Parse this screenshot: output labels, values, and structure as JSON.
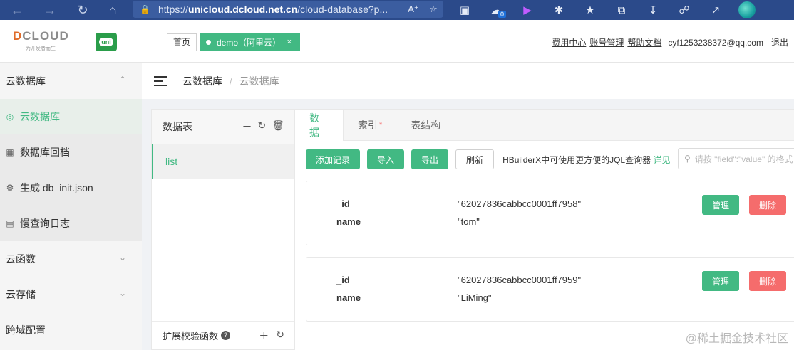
{
  "browser": {
    "url_scheme": "https://",
    "url_host": "unicloud.dcloud.net.cn",
    "url_path": "/cloud-database?p...",
    "notification_badge": "0"
  },
  "header": {
    "logo_text": "DCLOUD",
    "logo_subtitle": "为开发者而生",
    "uni_logo_text": "uni",
    "home_tab": "首页",
    "space_tab": "demo（阿里云）",
    "space_tab_close": "×",
    "links": [
      "费用中心",
      "账号管理",
      "帮助文档"
    ],
    "email": "cyf1253238372@qq.com",
    "logout": "退出"
  },
  "sidebar": {
    "group_cloud_db": "云数据库",
    "items": [
      {
        "label": "云数据库",
        "icon": "database-icon",
        "active": true
      },
      {
        "label": "数据库回档",
        "icon": "archive-icon",
        "active": false
      },
      {
        "label": "生成 db_init.json",
        "icon": "gear-icon",
        "active": false
      },
      {
        "label": "慢查询日志",
        "icon": "log-icon",
        "active": false
      }
    ],
    "group_functions": "云函数",
    "group_storage": "云存储",
    "cross_domain": "跨域配置"
  },
  "breadcrumb": {
    "level1": "云数据库",
    "separator": "/",
    "level2": "云数据库"
  },
  "tables_panel": {
    "title": "数据表",
    "tables": [
      "list"
    ],
    "footer_label": "扩展校验函数",
    "help_mark": "?"
  },
  "tabs": [
    {
      "label": "数据",
      "active": true
    },
    {
      "label": "索引",
      "active": false,
      "star": "*"
    },
    {
      "label": "表结构",
      "active": false
    }
  ],
  "toolbar": {
    "add": "添加记录",
    "import": "导入",
    "export": "导出",
    "refresh": "刷新",
    "hint": "HBuilderX中可使用更方便的JQL查询器",
    "hint_link": "详见",
    "search_placeholder": "请按 \"field\":\"value\" 的格式"
  },
  "records": [
    {
      "id_key": "_id",
      "id_value": "\"62027836cabbcc0001ff7958\"",
      "name_key": "name",
      "name_value": "\"tom\"",
      "manage": "管理",
      "delete": "删除"
    },
    {
      "id_key": "_id",
      "id_value": "\"62027836cabbcc0001ff7959\"",
      "name_key": "name",
      "name_value": "\"LiMing\"",
      "manage": "管理",
      "delete": "删除"
    }
  ],
  "watermark": "@稀土掘金技术社区",
  "colors": {
    "accent": "#42b983",
    "danger": "#f56c6c",
    "browser_bar": "#2b4a8a"
  }
}
